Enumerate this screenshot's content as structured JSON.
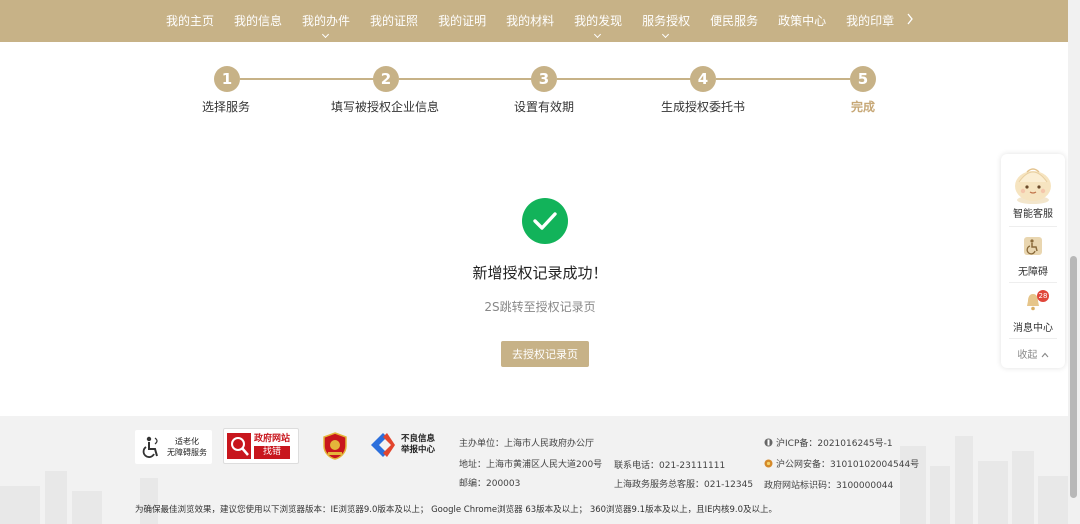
{
  "nav": {
    "items": [
      {
        "label": "我的主页",
        "dropdown": false
      },
      {
        "label": "我的信息",
        "dropdown": false
      },
      {
        "label": "我的办件",
        "dropdown": true
      },
      {
        "label": "我的证照",
        "dropdown": false
      },
      {
        "label": "我的证明",
        "dropdown": false
      },
      {
        "label": "我的材料",
        "dropdown": false
      },
      {
        "label": "我的发现",
        "dropdown": true
      },
      {
        "label": "服务授权",
        "dropdown": true
      },
      {
        "label": "便民服务",
        "dropdown": false
      },
      {
        "label": "政策中心",
        "dropdown": false
      },
      {
        "label": "我的印章",
        "dropdown": false
      }
    ],
    "next_icon": "chevron-right-icon"
  },
  "stepper": {
    "steps": [
      {
        "num": "1",
        "label": "选择服务",
        "active": false
      },
      {
        "num": "2",
        "label": "填写被授权企业信息",
        "active": false
      },
      {
        "num": "3",
        "label": "设置有效期",
        "active": false
      },
      {
        "num": "4",
        "label": "生成授权委托书",
        "active": false
      },
      {
        "num": "5",
        "label": "完成",
        "active": true
      }
    ]
  },
  "result": {
    "icon": "check-circle-icon",
    "title": "新增授权记录成功！",
    "subtitle": "2S跳转至授权记录页",
    "button_label": "去授权记录页"
  },
  "float_panel": {
    "service_label": "智能客服",
    "accessibility_label": "无障碍",
    "message_label": "消息中心",
    "message_badge": "28",
    "collapse_label": "收起"
  },
  "footer": {
    "logos": {
      "elderly_line1": "适老化",
      "elderly_line2": "无障碍服务",
      "gov_site_line1": "政府网站",
      "gov_site_line2": "找错",
      "report_line1": "不良信息",
      "report_line2": "举报中心"
    },
    "sponsor": "主办单位：上海市人民政府办公厅",
    "address": "地址：上海市黄浦区人民大道200号",
    "postcode": "邮编：200003",
    "phone": "联系电话：021-23111111",
    "hotline": "上海政务服务总客服：021-12345",
    "icp": "沪ICP备：2021016245号-1",
    "police": "沪公网安备：31010102004544号",
    "site_code": "政府网站标识码：3100000044",
    "browser_note": "为确保最佳浏览效果，建议您使用以下浏览器版本：IE浏览器9.0版本及以上； Google Chrome浏览器 63版本及以上； 360浏览器9.1版本及以上，且IE内核9.0及以上。"
  },
  "colors": {
    "accent": "#c7b287",
    "success": "#12b35a",
    "badge": "#e0463a"
  }
}
